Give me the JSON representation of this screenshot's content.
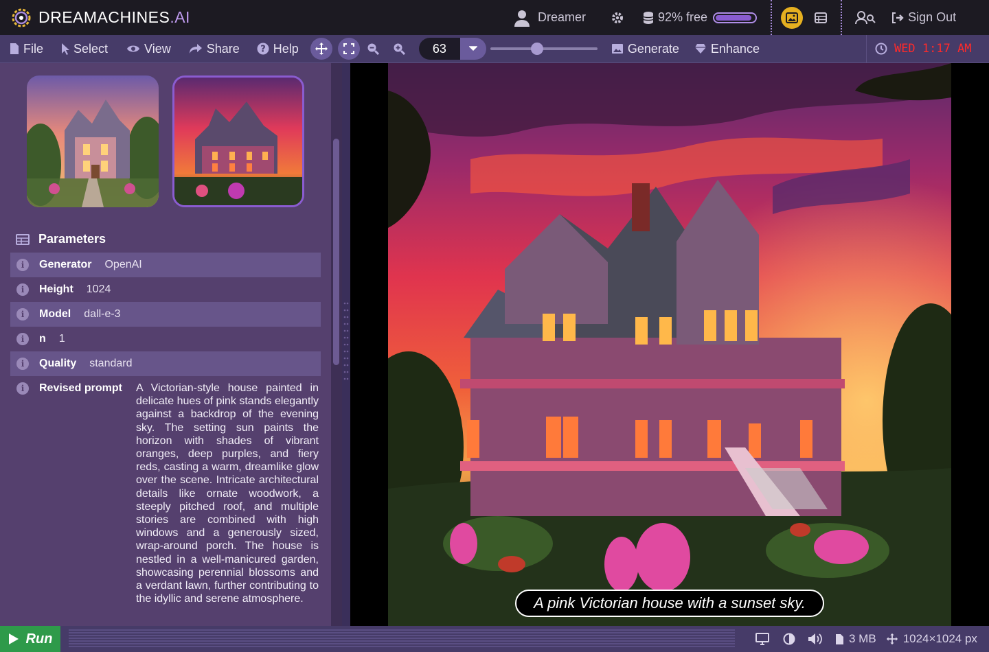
{
  "brand": {
    "name_main": "DREAMACHINES",
    "name_suffix": ".AI"
  },
  "top": {
    "user": "Dreamer",
    "storage": "92% free",
    "storage_fraction": 0.92,
    "sign_out": "Sign Out"
  },
  "toolbar": {
    "file": "File",
    "select": "Select",
    "view": "View",
    "share": "Share",
    "help": "Help",
    "zoom": "63",
    "slider_fraction": 0.43,
    "generate": "Generate",
    "enhance": "Enhance",
    "clock": "WED 1:17 AM"
  },
  "params": {
    "title": "Parameters",
    "rows": [
      {
        "key": "Generator",
        "value": "OpenAI"
      },
      {
        "key": "Height",
        "value": "1024"
      },
      {
        "key": "Model",
        "value": "dall-e-3"
      },
      {
        "key": "n",
        "value": "1"
      },
      {
        "key": "Quality",
        "value": "standard"
      }
    ],
    "revised_key": "Revised prompt",
    "revised_value": "A Victorian-style house painted in delicate hues of pink stands elegantly against a backdrop of the evening sky. The setting sun paints the horizon with shades of vibrant oranges, deep purples, and fiery reds, casting a warm, dreamlike glow over the scene. Intricate architectural details like ornate woodwork, a steeply pitched roof, and multiple stories are combined with high windows and a generously sized, wrap-around porch. The house is nestled in a well-manicured garden, showcasing perennial blossoms and a verdant lawn, further contributing to the idyllic and serene atmosphere."
  },
  "caption": "A pink Victorian house with a sunset sky.",
  "status": {
    "run": "Run",
    "size": "3 MB",
    "dims": "1024×1024 px"
  },
  "colors": {
    "accent": "#8a5cd0",
    "run": "#2e9a4a",
    "clock": "#ff2a2a"
  }
}
